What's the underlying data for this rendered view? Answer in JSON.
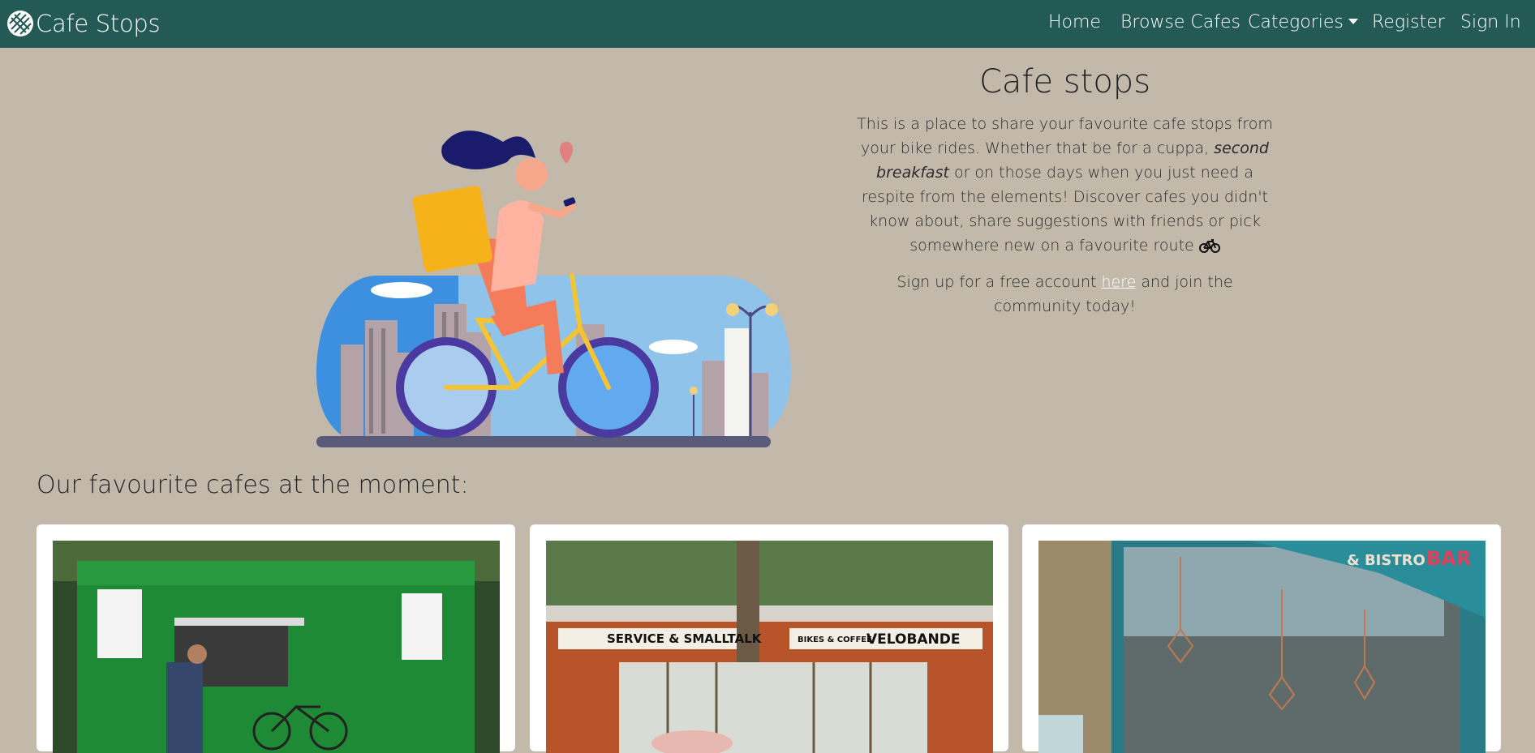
{
  "navbar": {
    "brand": "Cafe Stops",
    "items": [
      {
        "label": "Home"
      },
      {
        "label": "Browse Cafes"
      },
      {
        "label": "Categories"
      },
      {
        "label": "Register"
      },
      {
        "label": "Sign In"
      }
    ]
  },
  "hero": {
    "title": "Cafe stops",
    "para1": {
      "part1": "This is a place to share your favourite cafe stops from your bike rides. Whether that be for a cuppa, ",
      "emph": "second breakfast",
      "part2": " or on those days when you just need a respite from the elements! Discover cafes you didn't know about, share suggestions with friends or pick somewhere new on a favourite route "
    },
    "para2": {
      "before": "Sign up for a free account ",
      "link": "here",
      "after": " and join the community today!"
    }
  },
  "favourites": {
    "title": "Our favourite cafes at the moment:",
    "cards": [
      {
        "photo": "green-kiosk-cafe-photo"
      },
      {
        "photo": "velobande-cafe-photo",
        "sign_left": "SERVICE & SMALLTALK",
        "sign_right": "VELOBANDE",
        "sign_right_prefix": "BIKES & COFFEE"
      },
      {
        "photo": "glass-front-bistro-photo",
        "sign_text": "& BISTRO",
        "sign_brand": "BAR"
      }
    ]
  },
  "colors": {
    "navbar": "#245a56",
    "page_bg": "#c2b9ab",
    "card_bg": "#ffffff"
  }
}
